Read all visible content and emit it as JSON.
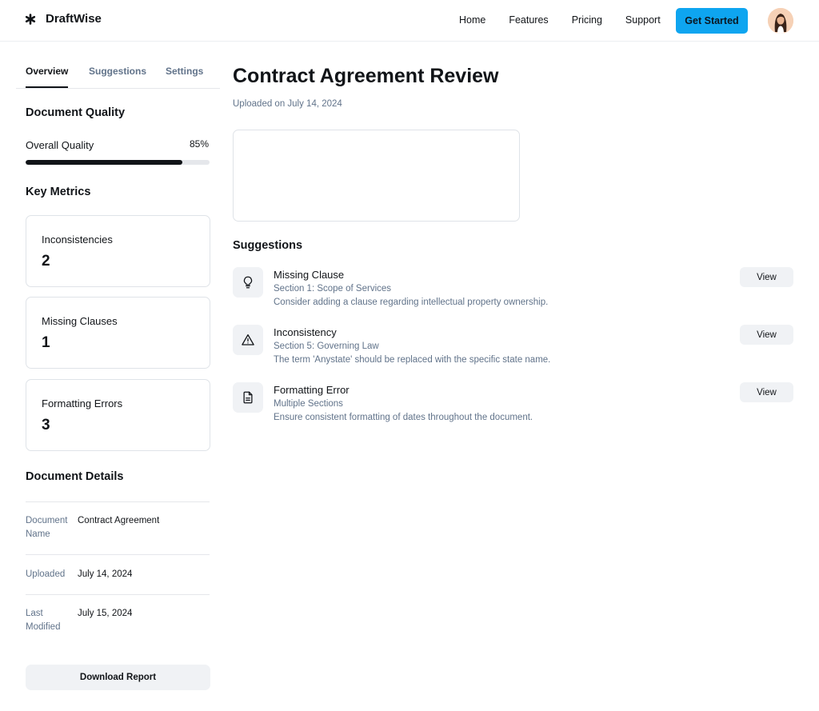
{
  "header": {
    "brand": "DraftWise",
    "nav": [
      "Home",
      "Features",
      "Pricing",
      "Support"
    ],
    "cta": "Get Started"
  },
  "sidebar": {
    "tabs": [
      {
        "label": "Overview",
        "active": true
      },
      {
        "label": "Suggestions",
        "active": false
      },
      {
        "label": "Settings",
        "active": false
      }
    ],
    "quality": {
      "title": "Document Quality",
      "label": "Overall Quality",
      "value_text": "85%",
      "percent": 85
    },
    "metrics_title": "Key Metrics",
    "metrics": [
      {
        "label": "Inconsistencies",
        "value": "2"
      },
      {
        "label": "Missing Clauses",
        "value": "1"
      },
      {
        "label": "Formatting Errors",
        "value": "3"
      }
    ],
    "details_title": "Document Details",
    "details": [
      {
        "key": "Document Name",
        "value": "Contract Agreement"
      },
      {
        "key": "Uploaded",
        "value": "July 14, 2024"
      },
      {
        "key": "Last Modified",
        "value": "July 15, 2024"
      }
    ],
    "download_label": "Download Report"
  },
  "main": {
    "title": "Contract Agreement Review",
    "uploaded_on": "Uploaded on July 14, 2024",
    "suggestions_title": "Suggestions",
    "suggestions": [
      {
        "icon": "lightbulb-icon",
        "title": "Missing Clause",
        "section": "Section 1: Scope of Services",
        "description": "Consider adding a clause regarding intellectual property ownership.",
        "action": "View"
      },
      {
        "icon": "warning-triangle-icon",
        "title": "Inconsistency",
        "section": "Section 5: Governing Law",
        "description": "The term 'Anystate' should be replaced with the specific state name.",
        "action": "View"
      },
      {
        "icon": "document-icon",
        "title": "Formatting Error",
        "section": "Multiple Sections",
        "description": "Ensure consistent formatting of dates throughout the document.",
        "action": "View"
      }
    ]
  },
  "colors": {
    "accent": "#0ea5f0",
    "text_primary": "#111418",
    "text_secondary": "#61738a",
    "surface_muted": "#f0f2f5",
    "border": "#dfe3e8"
  }
}
